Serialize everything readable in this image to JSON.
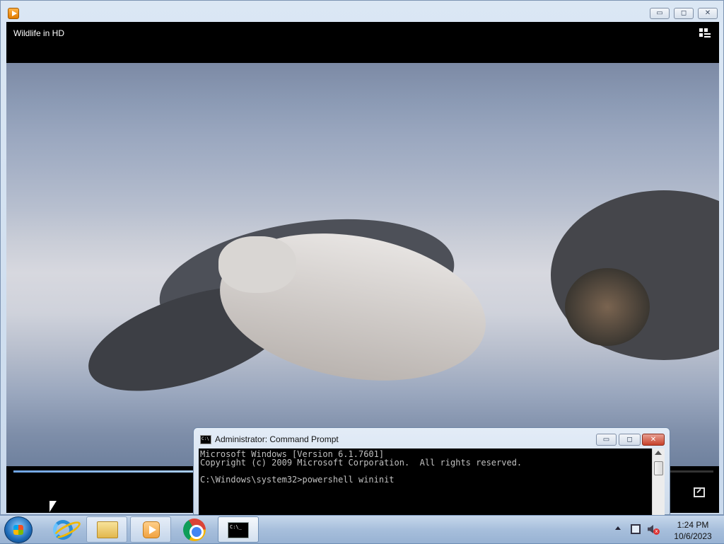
{
  "media_player": {
    "title": "Wildlife in HD",
    "window_buttons": {
      "minimize": "▭",
      "maximize": "◻",
      "close": "✕"
    },
    "progress": 0.26
  },
  "cmd": {
    "title": "Administrator: Command Prompt",
    "icon_text": "C:\\",
    "lines": [
      "Microsoft Windows [Version 6.1.7601]",
      "Copyright (c) 2009 Microsoft Corporation.  All rights reserved.",
      "",
      "C:\\Windows\\system32>powershell wininit"
    ],
    "buttons": {
      "minimize": "▭",
      "maximize": "◻",
      "close": "✕"
    }
  },
  "taskbar": {
    "items": [
      {
        "name": "internet-explorer",
        "icon": "ie-icon"
      },
      {
        "name": "windows-explorer",
        "icon": "folder-icon"
      },
      {
        "name": "windows-media-player",
        "icon": "media-player-icon"
      },
      {
        "name": "google-chrome",
        "icon": "chrome-icon"
      },
      {
        "name": "command-prompt",
        "icon": "cmd-icon",
        "icon_text": "C:\\_"
      }
    ],
    "clock": {
      "time": "1:24 PM",
      "date": "10/6/2023"
    },
    "volume_muted_mark": "x"
  },
  "colors": {
    "taskbar": "#a7bfdc",
    "window_frame": "#c9d9ec",
    "progress": "#6fa4e3",
    "close_red": "#c7412a"
  }
}
